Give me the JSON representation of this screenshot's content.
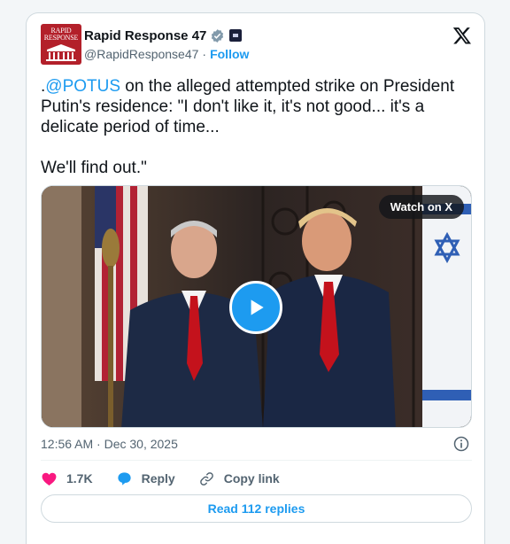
{
  "account": {
    "avatar_text": "RAPID RESPONSE",
    "name": "Rapid Response 47",
    "handle": "@RapidResponse47",
    "separator": "·",
    "follow_label": "Follow"
  },
  "tweet": {
    "prefix": ".",
    "mention": "@POTUS",
    "text": " on the alleged attempted strike on President Putin's residence: \"I don't like it, it's not good... it's a delicate period of time...\n\nWe'll find out.\""
  },
  "media": {
    "watch_label": "Watch on X",
    "play_icon": "play-icon"
  },
  "meta": {
    "timestamp": "12:56 AM · Dec 30, 2025"
  },
  "actions": {
    "like_count": "1.7K",
    "reply_label": "Reply",
    "copy_label": "Copy link"
  },
  "replies_button": "Read 112 replies",
  "colors": {
    "accent": "#1d9bf0",
    "like": "#f91880",
    "brand_red": "#b3202a"
  }
}
